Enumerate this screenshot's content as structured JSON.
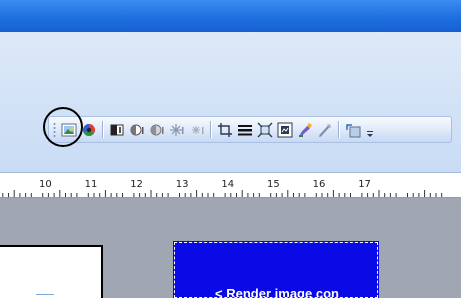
{
  "toolbar": {
    "buttons": [
      {
        "icon": "insert-picture-icon"
      },
      {
        "icon": "color-icon"
      },
      {
        "icon": "more-contrast-icon"
      },
      {
        "icon": "less-contrast-icon"
      },
      {
        "icon": "more-brightness-icon"
      },
      {
        "icon": "less-brightness-icon"
      },
      {
        "icon": "crop-icon"
      },
      {
        "icon": "line-style-icon"
      },
      {
        "icon": "compress-pictures-icon"
      },
      {
        "icon": "text-wrapping-icon"
      },
      {
        "icon": "format-picture-icon"
      },
      {
        "icon": "set-transparent-color-icon"
      },
      {
        "icon": "reset-picture-icon"
      }
    ]
  },
  "ruler": {
    "labels": [
      "10",
      "11",
      "12",
      "13",
      "14",
      "15",
      "16",
      "17"
    ]
  },
  "callout": {
    "text": "<   Render image con"
  },
  "colors": {
    "title_bar": "#1f6fe0",
    "toolbar_bg": "#c9dcf5",
    "workspace": "#a1a7b2",
    "callout_bg": "#0a0ae6",
    "highlight_circle": "#000000"
  }
}
